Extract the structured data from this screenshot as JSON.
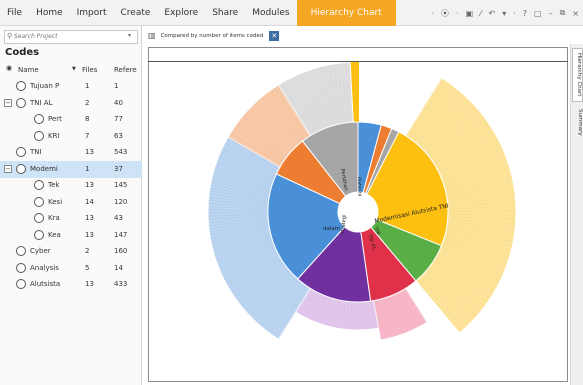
{
  "menu": {
    "items": [
      "File",
      "Home",
      "Import",
      "Create",
      "Explore",
      "Share",
      "Modules"
    ],
    "active_tab": "Hierarchy Chart"
  },
  "search": {
    "placeholder": "Search Project"
  },
  "codes_panel": {
    "title": "Codes",
    "headers": {
      "name": "Name",
      "files": "Files",
      "refs": "Refere"
    },
    "rows": [
      {
        "name": "Tujuan P",
        "files": "1",
        "refs": "1",
        "level": 0,
        "expander": ""
      },
      {
        "name": "TNI AL",
        "files": "2",
        "refs": "40",
        "level": 0,
        "expander": "⊟"
      },
      {
        "name": "Pert",
        "files": "8",
        "refs": "77",
        "level": 1,
        "expander": ""
      },
      {
        "name": "KRI",
        "files": "7",
        "refs": "63",
        "level": 1,
        "expander": ""
      },
      {
        "name": "TNI",
        "files": "13",
        "refs": "543",
        "level": 0,
        "expander": ""
      },
      {
        "name": "Modemi",
        "files": "1",
        "refs": "37",
        "level": 0,
        "expander": "⊟",
        "selected": true
      },
      {
        "name": "Tek",
        "files": "13",
        "refs": "145",
        "level": 1,
        "expander": ""
      },
      {
        "name": "Kesi",
        "files": "14",
        "refs": "120",
        "level": 1,
        "expander": ""
      },
      {
        "name": "Kra",
        "files": "13",
        "refs": "43",
        "level": 1,
        "expander": ""
      },
      {
        "name": "Kea",
        "files": "13",
        "refs": "147",
        "level": 1,
        "expander": ""
      },
      {
        "name": "Cyber",
        "files": "2",
        "refs": "160",
        "level": 0,
        "expander": ""
      },
      {
        "name": "Analysis",
        "files": "5",
        "refs": "14",
        "level": 0,
        "expander": ""
      },
      {
        "name": "Alutsista",
        "files": "13",
        "refs": "433",
        "level": 0,
        "expander": ""
      }
    ]
  },
  "chart_toolbar": {
    "label": "Compared by number of items coded"
  },
  "right_tabs": [
    "Hierarchy Chart",
    "Summary"
  ],
  "sunburst": {
    "inner_labels": [
      "Modernisasi Alutsista TNI",
      "dalam",
      "TNI AL",
      "TNI",
      "Pertahan",
      "strategi",
      "Alutsista"
    ],
    "colors": {
      "blue": "#4a90d9",
      "orange": "#f5a623",
      "yellow": "#fdc010",
      "gray": "#a6a6a6",
      "dark_orange": "#ed7d31",
      "purple": "#7030a0",
      "pink": "#d63c6b",
      "red": "#e0314b",
      "green": "#5aae46",
      "light_yellow": "#fde39a",
      "light_blue": "#bcd5f0",
      "light_gray": "#dedede",
      "light_orange": "#f8c9a8",
      "light_purple": "#e2c7ec",
      "light_pink": "#f7b7c8"
    }
  }
}
